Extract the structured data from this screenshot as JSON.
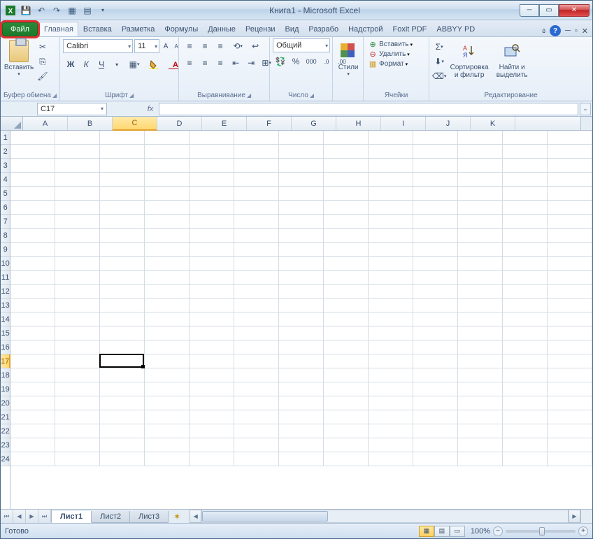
{
  "title": "Книга1 - Microsoft Excel",
  "qat": {
    "save": "💾",
    "undo": "↶",
    "redo": "↷"
  },
  "tabs": {
    "file": "Файл",
    "items": [
      "Главная",
      "Вставка",
      "Разметка",
      "Формулы",
      "Данные",
      "Рецензи",
      "Вид",
      "Разрабо",
      "Надстрой",
      "Foxit PDF",
      "ABBYY PD"
    ],
    "active": 0
  },
  "ribbon": {
    "clipboard": {
      "paste": "Вставить",
      "label": "Буфер обмена"
    },
    "font": {
      "name": "Calibri",
      "size": "11",
      "label": "Шрифт"
    },
    "alignment": {
      "label": "Выравнивание"
    },
    "number": {
      "format": "Общий",
      "label": "Число"
    },
    "styles": {
      "btn": "Стили"
    },
    "cells": {
      "insert": "Вставить",
      "delete": "Удалить",
      "format": "Формат",
      "label": "Ячейки"
    },
    "editing": {
      "sort": "Сортировка и фильтр",
      "find": "Найти и выделить",
      "label": "Редактирование"
    }
  },
  "namebox": "C17",
  "fx": "fx",
  "columns": [
    "A",
    "B",
    "C",
    "D",
    "E",
    "F",
    "G",
    "H",
    "I",
    "J",
    "K"
  ],
  "rows": [
    1,
    2,
    3,
    4,
    5,
    6,
    7,
    8,
    9,
    10,
    11,
    12,
    13,
    14,
    15,
    16,
    17,
    18,
    19,
    20,
    21,
    22,
    23,
    24
  ],
  "selected": {
    "row": 17,
    "col": "C",
    "colIndex": 2
  },
  "sheets": [
    "Лист1",
    "Лист2",
    "Лист3"
  ],
  "active_sheet": 0,
  "status": "Готово",
  "zoom": "100%"
}
